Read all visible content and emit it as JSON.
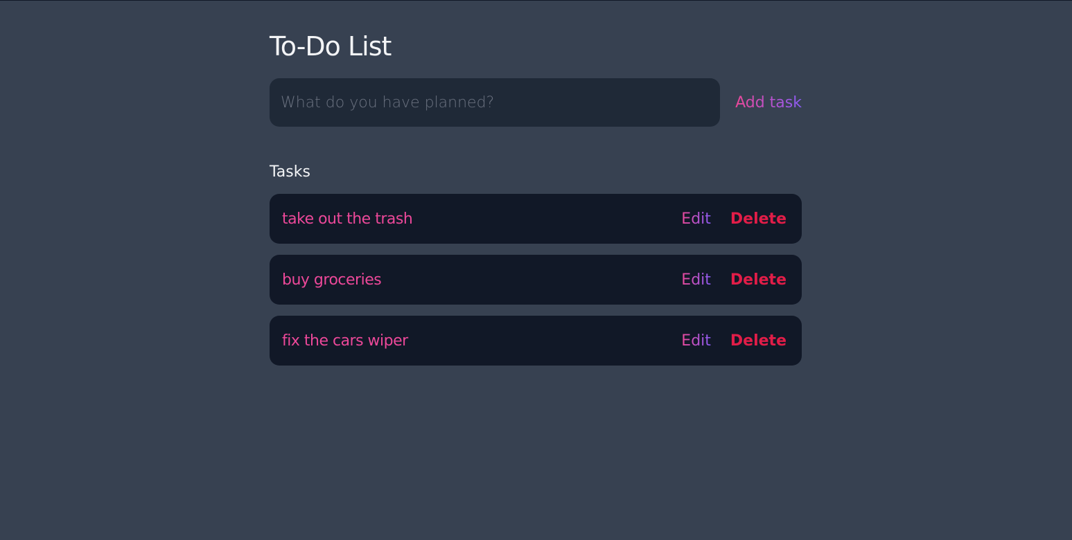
{
  "header": {
    "title": "To-Do List"
  },
  "new_task_form": {
    "input_value": "",
    "input_placeholder": "What do you have planned?",
    "add_button_label": "Add task"
  },
  "tasks_section": {
    "heading": "Tasks",
    "edit_label": "Edit",
    "delete_label": "Delete",
    "items": [
      {
        "text": "take out the trash"
      },
      {
        "text": "buy groceries"
      },
      {
        "text": "fix the cars wiper"
      }
    ]
  },
  "colors": {
    "background": "#374151",
    "input_background": "#1f2937",
    "task_background": "#111827",
    "task_text": "#ec4899",
    "accent_gradient_start": "#ec4899",
    "accent_gradient_end": "#8b5cf6",
    "delete": "#e11d48",
    "heading": "#f3f4f6"
  }
}
